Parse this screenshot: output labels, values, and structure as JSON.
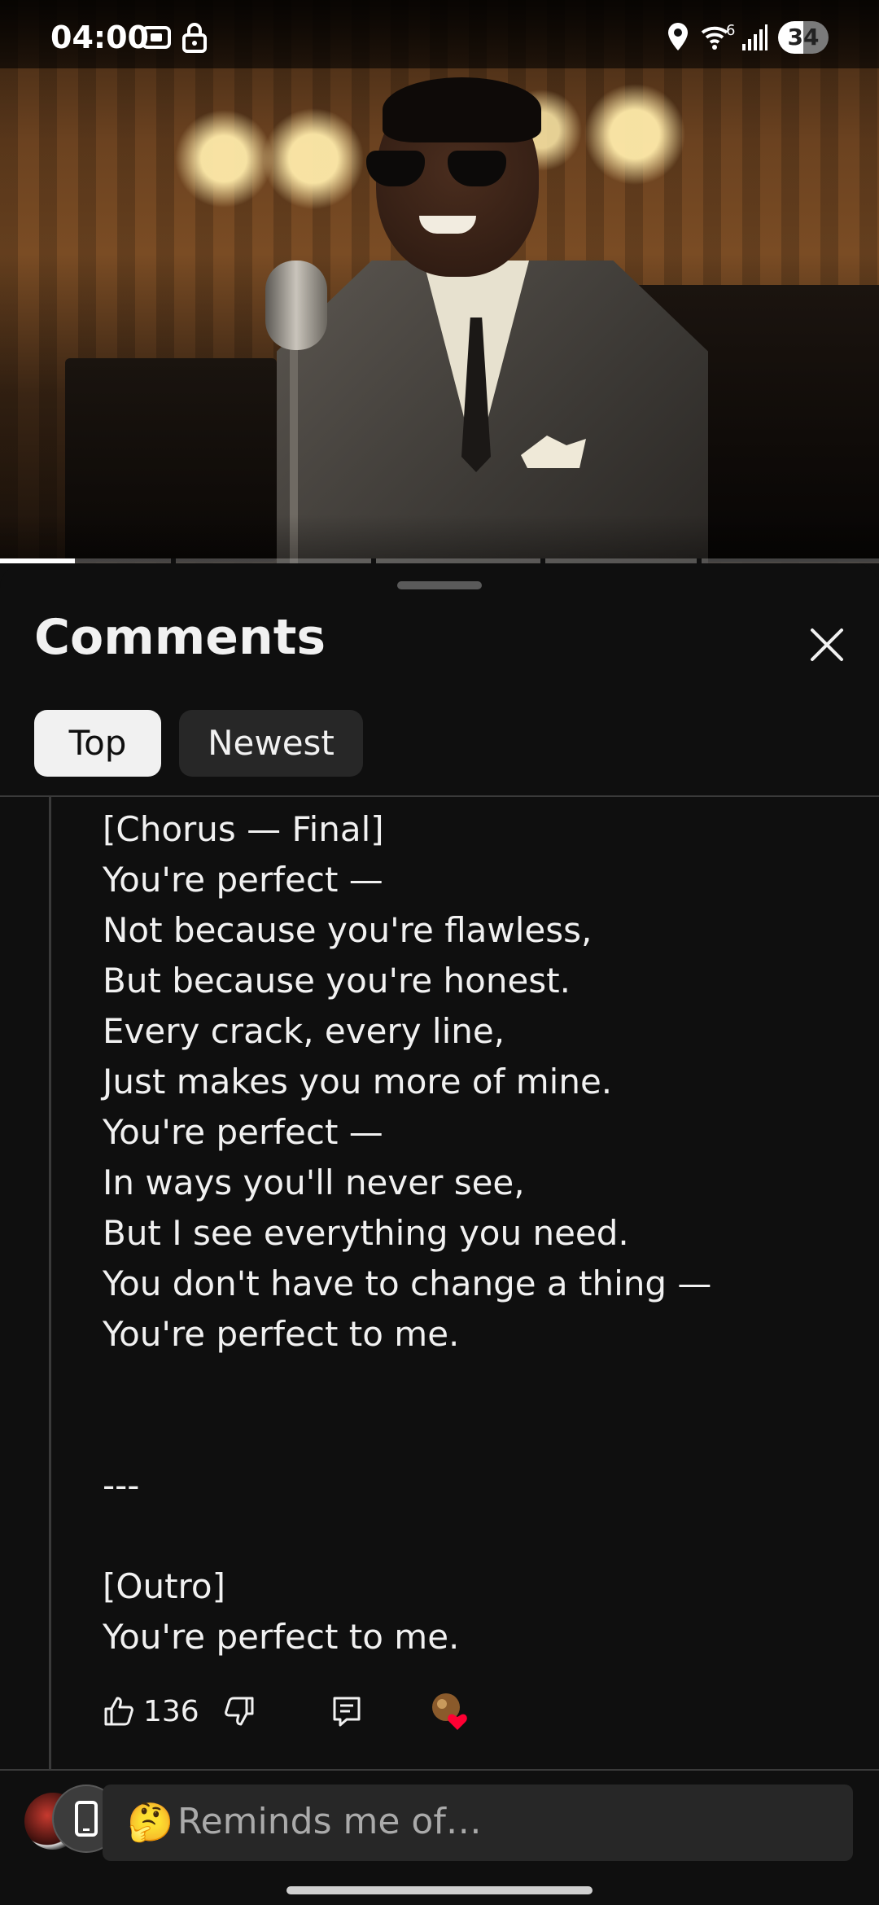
{
  "status_bar": {
    "time": "04:00",
    "icons": [
      "screenshot-icon",
      "lock-icon",
      "location-icon",
      "wifi-icon",
      "signal-icon"
    ],
    "battery_level": "34",
    "wifi_label": "6"
  },
  "video": {
    "progress_fraction": 0.085
  },
  "comments_sheet": {
    "title": "Comments",
    "filters": [
      {
        "label": "Top",
        "selected": true
      },
      {
        "label": "Newest",
        "selected": false
      }
    ],
    "comment": {
      "lines": [
        "[Chorus — Final]",
        "You're perfect —",
        "Not because you're flawless,",
        "But because you're honest.",
        "Every crack, every line,",
        "Just makes you more of mine.",
        "You're perfect —",
        "In ways you'll never see,",
        "But I see everything you need.",
        "You don't have to change a thing —",
        "You're perfect to me.",
        "",
        "",
        "---",
        "",
        "[Outro]",
        "You're perfect to me."
      ],
      "like_count": "136"
    },
    "composer": {
      "emoji": "🤔",
      "placeholder": "Reminds me of…"
    }
  },
  "colors": {
    "background": "#0f0f0f",
    "chip_selected": "#f1f1f1",
    "chip_unselected": "#272727",
    "heart": "#ff0033"
  }
}
